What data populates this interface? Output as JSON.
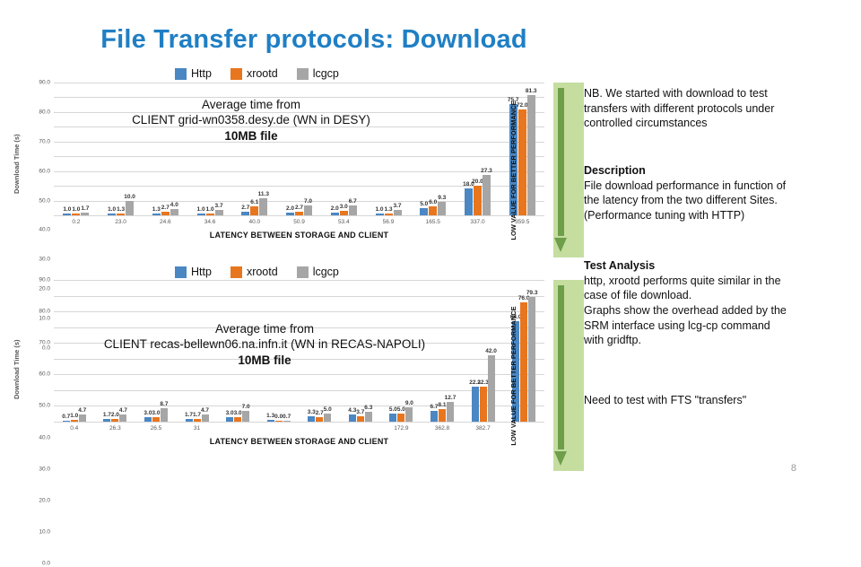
{
  "slide": {
    "title": "File Transfer protocols: Download",
    "page_number": "8",
    "title_color": "#1f7fc4"
  },
  "series_colors": {
    "http": "#4a87c3",
    "xrootd": "#e8761e",
    "lcgcp": "#a6a6a6"
  },
  "legend": {
    "items": [
      {
        "label": "Http",
        "color": "#4a87c3",
        "icon": "legend-swatch"
      },
      {
        "label": "xrootd",
        "color": "#e8761e",
        "icon": "legend-swatch"
      },
      {
        "label": "lcgcp",
        "color": "#a6a6a6",
        "icon": "legend-swatch"
      }
    ]
  },
  "arrow_band": {
    "text": "LOW VALUE FOR BETTER PERFORMANCE",
    "color": "#c5dea0",
    "arrow_color": "#6f9e4b"
  },
  "right_column": {
    "nb": [
      "NB. We started with download to test",
      "transfers with different protocols under",
      "controlled circumstances"
    ],
    "description_heading": "Description",
    "description": [
      "File download performance in function of",
      "the latency from the two different Sites.",
      "(Performance tuning with HTTP)"
    ],
    "analysis_heading": "Test Analysis",
    "analysis": [
      "http, xrootd performs quite similar in the",
      "case of file download.",
      "Graphs show the overhead added by the",
      "SRM interface using lcg-cp command",
      "with gridftp."
    ],
    "footer": "Need to test with FTS \"transfers\""
  },
  "chart_data": [
    {
      "type": "bar",
      "id": "chart-desy",
      "title": "",
      "annotation": [
        "Average time from",
        "CLIENT grid-wn0358.desy.de (WN in DESY)",
        "10MB file"
      ],
      "annotation_bold_line": 2,
      "xlabel": "LATENCY BETWEEN STORAGE AND  CLIENT",
      "ylabel": "Download Time (s)",
      "ylim": [
        0,
        90
      ],
      "yticks": [
        0.0,
        10.0,
        20.0,
        30.0,
        40.0,
        50.0,
        60.0,
        70.0,
        80.0,
        90.0
      ],
      "ytick_labels": [
        "0.0",
        "10.0",
        "20.0",
        "30.0",
        "40.0",
        "50.0",
        "60.0",
        "70.0",
        "80.0",
        "90.0"
      ],
      "grid": true,
      "legend_position": "top",
      "categories": [
        "0.2",
        "23.0",
        "24.6",
        "34.6",
        "40.0",
        "50.9",
        "53.4",
        "56.9",
        "165.5",
        "337.0",
        "359.5"
      ],
      "series": [
        {
          "name": "Http",
          "color": "#4a87c3",
          "values": [
            1.0,
            1.0,
            1.3,
            1.0,
            2.7,
            2.0,
            2.0,
            1.0,
            5.0,
            18.0,
            75.7
          ],
          "labels": [
            "1.0",
            "1.0",
            "1.3",
            "1.0",
            "2.7",
            "2.0",
            "2.0",
            "1.0",
            "5.0",
            "18.0",
            "75.7"
          ]
        },
        {
          "name": "xrootd",
          "color": "#e8761e",
          "values": [
            1.0,
            1.3,
            2.7,
            1.0,
            6.1,
            2.7,
            3.0,
            1.3,
            6.0,
            20.0,
            72.0
          ],
          "labels": [
            "1.0",
            "1.3",
            "2.7",
            "1.0",
            "6.1",
            "2.7",
            "3.0",
            "1.3",
            "6.0",
            "20.0",
            "72.0"
          ]
        },
        {
          "name": "lcgcp",
          "color": "#a6a6a6",
          "values": [
            1.7,
            10.0,
            4.0,
            3.7,
            11.3,
            7.0,
            6.7,
            3.7,
            9.3,
            27.3,
            81.3
          ],
          "labels": [
            "1.7",
            "10.0",
            "4.0",
            "3.7",
            "11.3",
            "7.0",
            "6.7",
            "3.7",
            "9.3",
            "27.3",
            "81.3"
          ]
        }
      ]
    },
    {
      "type": "bar",
      "id": "chart-napoli",
      "title": "",
      "annotation": [
        "Average time from",
        "CLIENT recas-bellewn06.na.infn.it  (WN in RECAS-NAPOLI)",
        "10MB file"
      ],
      "annotation_bold_line": 2,
      "xlabel": "LATENCY BETWEEN STORAGE AND  CLIENT",
      "ylabel": "Download Time (s)",
      "ylim": [
        0,
        90
      ],
      "yticks": [
        0.0,
        10.0,
        20.0,
        30.0,
        40.0,
        50.0,
        60.0,
        70.0,
        80.0,
        90.0
      ],
      "ytick_labels": [
        "0.0",
        "10.0",
        "20.0",
        "30.0",
        "40.0",
        "50.0",
        "60.0",
        "70.0",
        "80.0",
        "90.0"
      ],
      "grid": true,
      "legend_position": "top",
      "categories": [
        "0.4",
        "26.3",
        "26.5",
        "31",
        "",
        "",
        "",
        "",
        "172.9",
        "362.8",
        "382.7"
      ],
      "series": [
        {
          "name": "Http",
          "color": "#4a87c3",
          "values": [
            0.7,
            1.7,
            3.0,
            1.7,
            3.0,
            1.3,
            3.3,
            4.3,
            5.0,
            6.7,
            22.3,
            64.0
          ],
          "labels": [
            "0.7",
            "1.7",
            "3.0",
            "1.7",
            "3.0",
            "1.3",
            "3.3",
            "4.3",
            "5.0",
            "6.7",
            "22.3",
            "64.0"
          ]
        },
        {
          "name": "xrootd",
          "color": "#e8761e",
          "values": [
            1.0,
            2.0,
            3.0,
            1.7,
            3.0,
            0.0,
            2.7,
            3.7,
            5.0,
            8.1,
            22.3,
            76.0
          ],
          "labels": [
            "1.0",
            "2.0",
            "3.0",
            "1.7",
            "3.0",
            "0.0",
            "2.7",
            "3.7",
            "5.0",
            "8.1",
            "22.3",
            "76.0"
          ]
        },
        {
          "name": "lcgcp",
          "color": "#a6a6a6",
          "values": [
            4.7,
            4.7,
            8.7,
            4.7,
            7.0,
            0.7,
            5.0,
            6.3,
            9.0,
            12.7,
            42.0,
            79.3
          ],
          "labels": [
            "4.7",
            "4.7",
            "8.7",
            "4.7",
            "7.0",
            "0.7",
            "5.0",
            "6.3",
            "9.0",
            "12.7",
            "42.0",
            "79.3"
          ]
        }
      ]
    }
  ]
}
